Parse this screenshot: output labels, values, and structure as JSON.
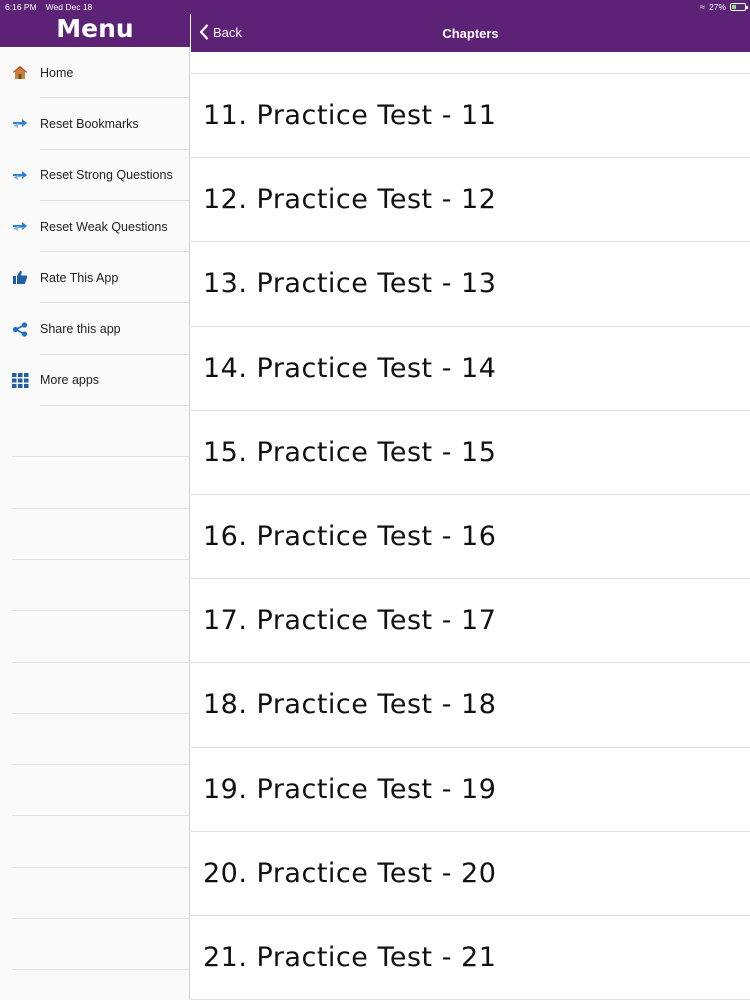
{
  "status": {
    "time": "6:16 PM",
    "date": "Wed Dec 18",
    "battery": "27%"
  },
  "menu": {
    "title": "Menu",
    "items": [
      {
        "label": "Home",
        "icon": "home-icon"
      },
      {
        "label": "Reset Bookmarks",
        "icon": "reset-arrows-icon"
      },
      {
        "label": "Reset Strong Questions",
        "icon": "reset-arrows-icon"
      },
      {
        "label": "Reset Weak Questions",
        "icon": "reset-arrows-icon"
      },
      {
        "label": "Rate This App",
        "icon": "thumbs-up-icon"
      },
      {
        "label": "Share this app",
        "icon": "share-icon"
      },
      {
        "label": "More apps",
        "icon": "grid-icon"
      }
    ]
  },
  "nav": {
    "back_label": "Back",
    "title": "Chapters"
  },
  "chapters": [
    "11. Practice Test - 11",
    "12. Practice Test - 12",
    "13. Practice Test - 13",
    "14. Practice Test - 14",
    "15. Practice Test - 15",
    "16. Practice Test - 16",
    "17. Practice Test - 17",
    "18. Practice Test - 18",
    "19. Practice Test - 19",
    "20. Practice Test - 20",
    "21. Practice Test - 21"
  ],
  "colors": {
    "header": "#5b2275",
    "accent_blue": "#1f6fc4"
  }
}
